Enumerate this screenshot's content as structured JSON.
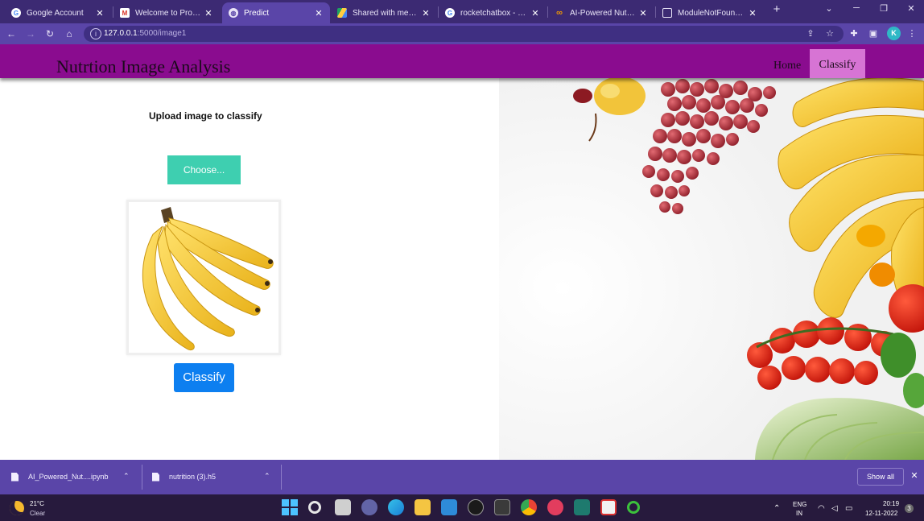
{
  "browser": {
    "tabs": [
      {
        "title": "Google Account",
        "favicon": "google-icon",
        "active": false
      },
      {
        "title": "Welcome to ProjectEd",
        "favicon": "gmail-icon",
        "active": false
      },
      {
        "title": "Predict",
        "favicon": "globe-icon",
        "active": true
      },
      {
        "title": "Shared with me - Google Drive",
        "favicon": "drive-icon",
        "active": false
      },
      {
        "title": "rocketchatbox - Google Search",
        "favicon": "google-icon",
        "active": false
      },
      {
        "title": "AI-Powered Nutrition",
        "favicon": "infinity-icon",
        "active": false
      },
      {
        "title": "ModuleNotFoundError",
        "favicon": "cube-icon",
        "active": false
      }
    ],
    "new_tab_symbol": "+",
    "url_host": "127.0.0.1",
    "url_rest": ":5000/image1",
    "profile_initial": "K"
  },
  "page": {
    "site_title": "Nutrtion Image Analysis",
    "nav": {
      "home": "Home",
      "classify": "Classify"
    },
    "upload_label": "Upload image to classify",
    "choose_label": "Choose...",
    "classify_label": "Classify",
    "preview_image": "banana-bunch"
  },
  "downloads": {
    "items": [
      {
        "name": "AI_Powered_Nut....ipynb"
      },
      {
        "name": "nutrition (3).h5"
      }
    ],
    "show_all": "Show all"
  },
  "taskbar": {
    "weather_temp": "21°C",
    "weather_condition": "Clear",
    "language_line1": "ENG",
    "language_line2": "IN",
    "time": "20:19",
    "date": "12-11-2022",
    "notification_count": "3"
  },
  "colors": {
    "tab_strip": "#3c2a73",
    "toolbar": "#5a45a8",
    "navbar": "#8a0c8f",
    "nav_active": "#d774d4",
    "choose_button": "#3ecfb0",
    "classify_button": "#0d7ff0",
    "taskbar": "#271a3d"
  }
}
